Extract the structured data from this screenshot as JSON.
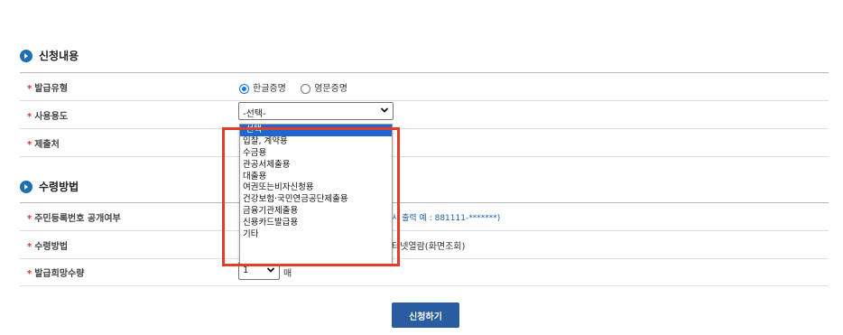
{
  "section1": {
    "title": "신청내용",
    "rows": {
      "issue_type": {
        "label": "발급유형",
        "options": [
          "한글증명",
          "영문증명"
        ],
        "selected": "한글증명"
      },
      "purpose": {
        "label": "사용용도",
        "selected": "-선택-"
      },
      "submit_to": {
        "label": "제출처"
      }
    }
  },
  "section2": {
    "title": "수령방법",
    "rows": {
      "resident_no": {
        "label": "주민등록번호 공개여부",
        "value_partial": "시 출력 예 : 881111-*******)"
      },
      "receipt_method": {
        "label": "수령방법",
        "value_partial": "터넷열람(화면조회)"
      },
      "quantity": {
        "label": "발급희망수량",
        "selected": "1",
        "unit": "매"
      }
    }
  },
  "dropdown": {
    "options": [
      "-선택-",
      "입찰, 계약용",
      "수금용",
      "관공서제출용",
      "대출용",
      "여권또는비자신청용",
      "건강보험·국민연금공단제출용",
      "금융기관제출용",
      "신용카드발급용",
      "기타"
    ],
    "highlighted": "-선택-"
  },
  "submit_label": "신청하기",
  "colors": {
    "accent": "#2a5d9f",
    "highlight_border": "#e23d2a",
    "required_star": "#d9342b"
  }
}
